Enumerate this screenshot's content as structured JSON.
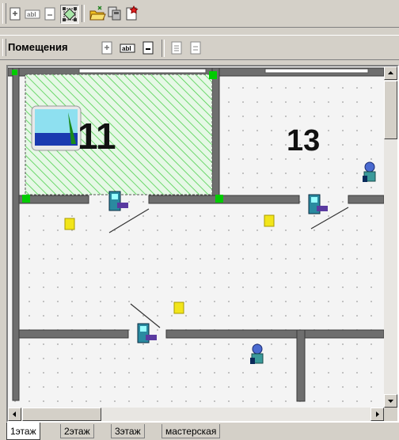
{
  "toolbar_top": {
    "buttons": [
      "add-object-icon",
      "rename-text-icon",
      "delete-page-icon",
      "select-region-icon",
      "open-folder-icon",
      "copy-icon",
      "new-document-icon"
    ]
  },
  "toolbar_rooms": {
    "label": "Помещения",
    "buttons": [
      "add-room-icon",
      "rename-room-icon",
      "delete-room-icon",
      "room-properties-icon",
      "room-info-icon"
    ]
  },
  "plan": {
    "room_labels": [
      "11",
      "13"
    ]
  },
  "tabs": [
    {
      "label": "1этаж",
      "active": true
    },
    {
      "label": "2этаж",
      "active": false
    },
    {
      "label": "3этаж",
      "active": false
    },
    {
      "label": "мастерская",
      "active": false
    }
  ],
  "colors": {
    "selection_hatch": "#4fd04f",
    "selection_handle": "#00cc00",
    "wall": "#6e6e6e",
    "sensor": "#f2e51a"
  }
}
